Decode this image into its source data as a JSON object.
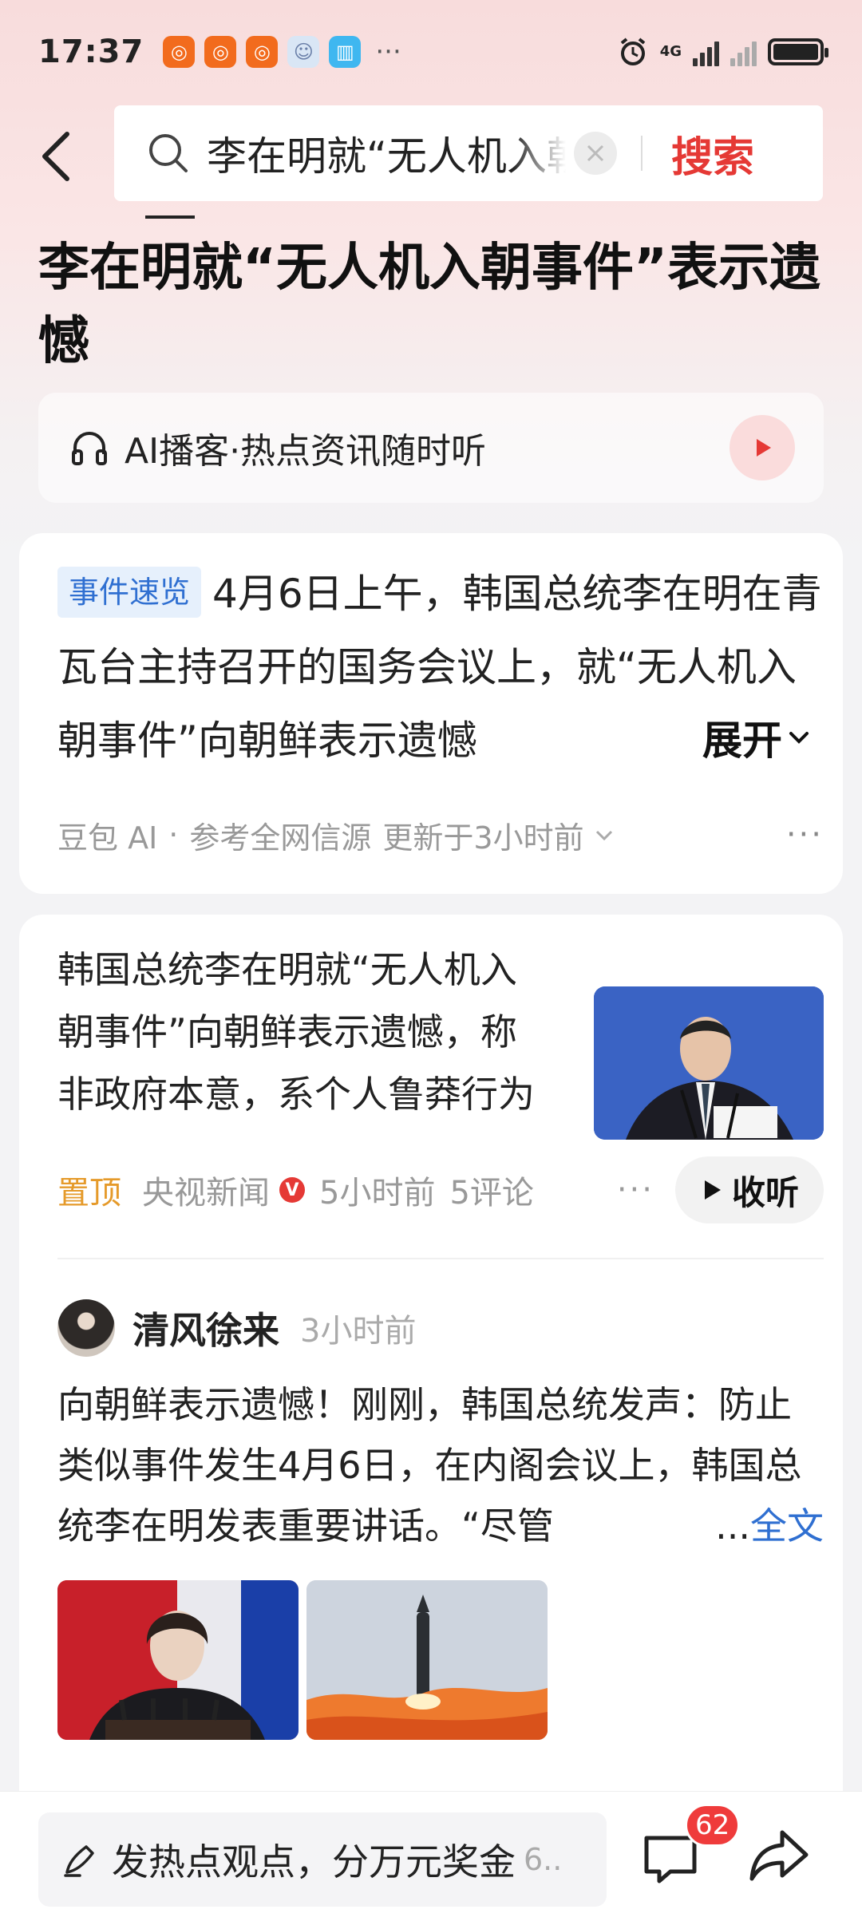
{
  "status_bar": {
    "time": "17:37",
    "more": "···",
    "network_label": "4G",
    "icons": [
      "weibo-app-icon",
      "weibo-app-icon",
      "weibo-app-icon",
      "face-app-icon",
      "book-app-icon",
      "alarm-icon",
      "signal-icon",
      "battery-icon"
    ]
  },
  "header": {
    "search_query": "李在明就“无人机入朝事件”表示遗憾",
    "search_button": "搜索"
  },
  "article": {
    "title": "李在明就“无人机入朝事件”表示遗憾"
  },
  "podcast": {
    "label": "AI播客·热点资讯随时听"
  },
  "summary": {
    "tag": "事件速览",
    "text": "4月6日上午，韩国总统李在明在青瓦台主持召开的国务会议上，就“无人机入朝事件”向朝鲜表示遗憾",
    "expand": "展开",
    "source": "豆包 AI",
    "separator": "·",
    "ref": "参考全网信源",
    "updated": "更新于3小时前",
    "more": "···"
  },
  "news_item": {
    "title": "韩国总统李在明就“无人机入朝事件”向朝鲜表示遗憾，称非政府本意，系个人鲁莽行为",
    "pin": "置顶",
    "source": "央视新闻",
    "verified": "V",
    "time": "5小时前",
    "comments": "5评论",
    "more": "···",
    "listen": "收听"
  },
  "post": {
    "author": "清风徐来",
    "time": "3小时前",
    "body": "向朝鲜表示遗憾！刚刚，韩国总统发声：防止类似事件发生4月6日，在内阁会议上，韩国总统李在明发表重要讲话。“尽管",
    "ellipsis": "...",
    "fulltext": "全文"
  },
  "bottom_bar": {
    "comment_placeholder": "发热点观点，分万元奖金",
    "comment_more": "6..",
    "comment_count": "62"
  },
  "colors": {
    "accent_red": "#e53935",
    "link_blue": "#2f6fd1",
    "pin_orange": "#e59a2a"
  }
}
